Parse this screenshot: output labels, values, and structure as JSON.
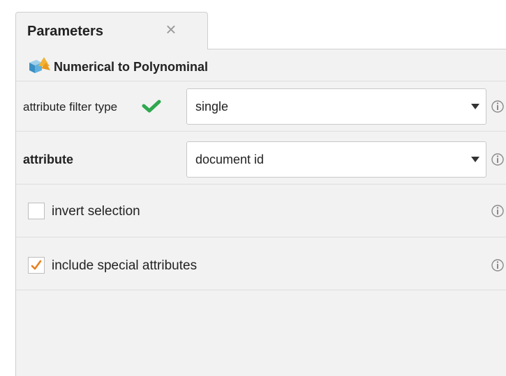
{
  "tab": {
    "title": "Parameters",
    "close_symbol": "×"
  },
  "operator": {
    "title": "Numerical to Polynominal",
    "icon": "operator-cube-icon"
  },
  "parameters": {
    "attribute_filter_type": {
      "label": "attribute filter type",
      "value": "single",
      "status_icon": "green-check-icon"
    },
    "attribute": {
      "label": "attribute",
      "value": "document id"
    },
    "invert_selection": {
      "label": "invert selection",
      "checked": false
    },
    "include_special_attributes": {
      "label": "include special attributes",
      "checked": true
    }
  },
  "colors": {
    "check_green": "#2fa84f",
    "checkbox_orange": "#e8801e",
    "panel_bg": "#f2f2f2",
    "info_gray": "#8a8a8a"
  }
}
